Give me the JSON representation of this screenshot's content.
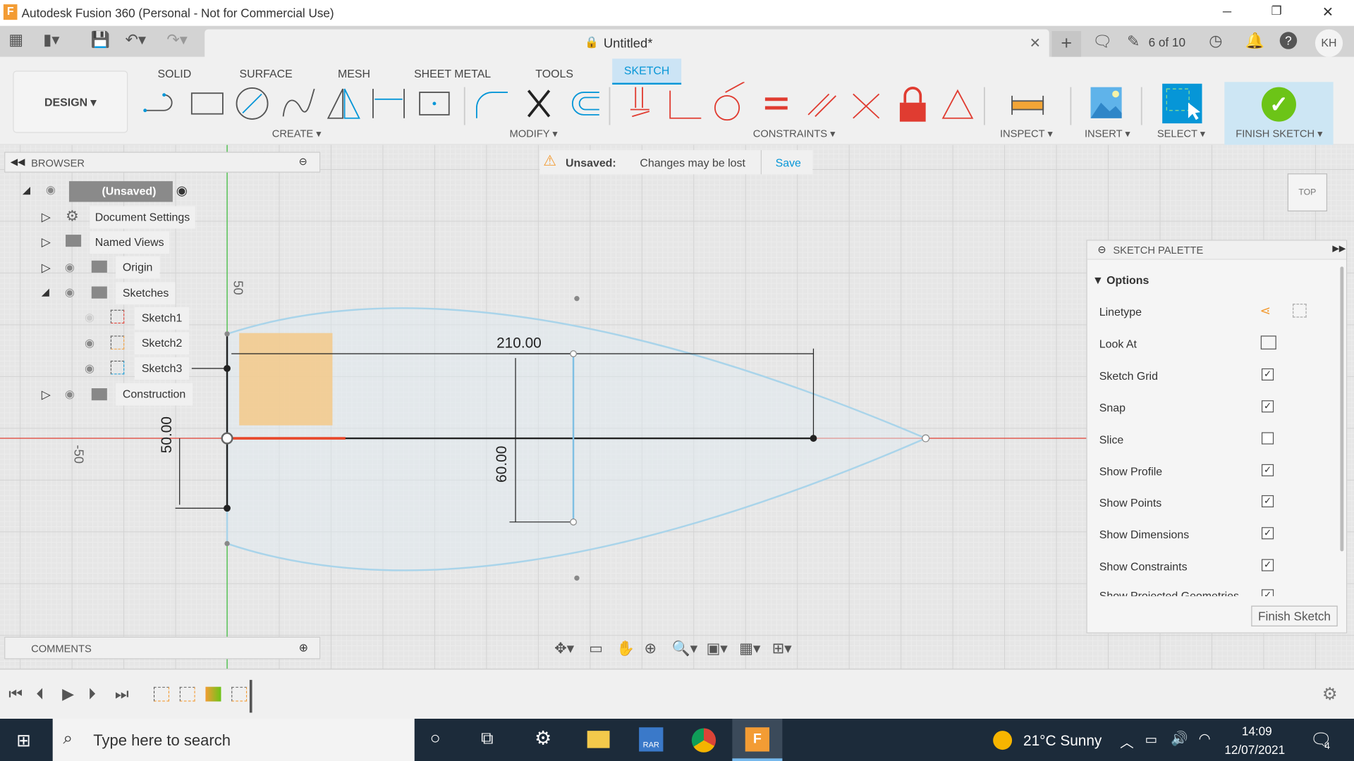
{
  "window": {
    "title": "Autodesk Fusion 360 (Personal - Not for Commercial Use)",
    "min": "─",
    "restore": "❐",
    "close": "✕"
  },
  "qat": {
    "doc_title": "Untitled*",
    "job_status": "6 of 10",
    "user": "KH"
  },
  "ribbon": {
    "workspace": "DESIGN ▾",
    "tabs": [
      "SOLID",
      "SURFACE",
      "MESH",
      "SHEET METAL",
      "TOOLS",
      "SKETCH"
    ],
    "groups": {
      "create": "CREATE ▾",
      "modify": "MODIFY ▾",
      "constraints": "CONSTRAINTS ▾",
      "inspect": "INSPECT ▾",
      "insert": "INSERT ▾",
      "select": "SELECT ▾",
      "finish": "FINISH SKETCH ▾"
    }
  },
  "browser": {
    "title": "BROWSER",
    "root": "(Unsaved)",
    "items": [
      {
        "label": "Document Settings"
      },
      {
        "label": "Named Views"
      },
      {
        "label": "Origin"
      },
      {
        "label": "Sketches"
      },
      {
        "label": "Sketch1"
      },
      {
        "label": "Sketch2"
      },
      {
        "label": "Sketch3"
      },
      {
        "label": "Construction"
      }
    ]
  },
  "banner": {
    "label": "Unsaved:",
    "message": "Changes may be lost",
    "action": "Save"
  },
  "viewcube": {
    "face": "TOP"
  },
  "sketch": {
    "dim_length": "210.00",
    "dim_height": "60.00",
    "dim_offset": "50.00",
    "grid_label_pos": "50",
    "grid_label_neg": "-50"
  },
  "palette": {
    "title": "SKETCH PALETTE",
    "section": "Options",
    "rows": [
      {
        "label": "Linetype"
      },
      {
        "label": "Look At"
      },
      {
        "label": "Sketch Grid",
        "checked": true
      },
      {
        "label": "Snap",
        "checked": true
      },
      {
        "label": "Slice",
        "checked": false
      },
      {
        "label": "Show Profile",
        "checked": true
      },
      {
        "label": "Show Points",
        "checked": true
      },
      {
        "label": "Show Dimensions",
        "checked": true
      },
      {
        "label": "Show Constraints",
        "checked": true
      },
      {
        "label": "Show Projected Geometries",
        "checked": true
      }
    ],
    "finish": "Finish Sketch"
  },
  "comments": {
    "title": "COMMENTS"
  },
  "taskbar": {
    "search_placeholder": "Type here to search",
    "weather": "21°C  Sunny",
    "time": "14:09",
    "date": "12/07/2021",
    "notifications": "4"
  },
  "colors": {
    "accent": "#0696d7",
    "finish": "#6cc417",
    "axis_x": "#e03c31",
    "axis_y": "#3bbf3b",
    "curve": "#a9d4ea",
    "profile": "#f3c98a"
  }
}
